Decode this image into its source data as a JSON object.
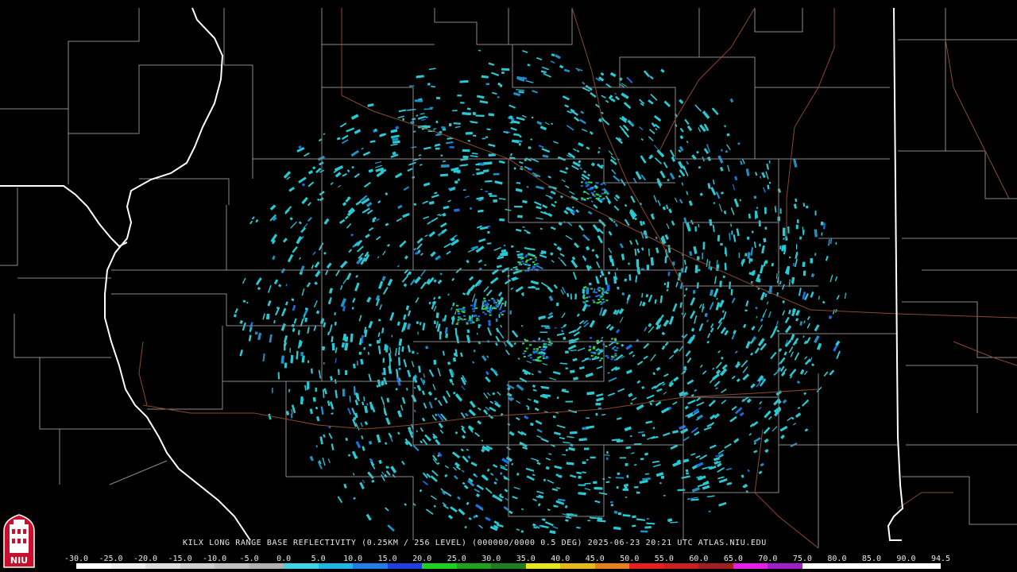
{
  "product": {
    "caption": "KILX LONG RANGE BASE REFLECTIVITY (0.25KM / 256 LEVEL) (000000/0000 0.5 DEG) 2025-06-23 20:21 UTC  ATLAS.NIU.EDU"
  },
  "logo": {
    "text": "NIU",
    "color": "#c8102e"
  },
  "colors": {
    "background": "#000000",
    "county_border": "#8a8a8a",
    "state_border": "#ffffff",
    "road": "#8b4a2b",
    "echo_main": "#29c9d4",
    "echo_weak": "#1e90c8",
    "echo_mid": "#1a6fe0",
    "echo_green": "#33d94a"
  },
  "color_scale": {
    "labels": [
      "-30.0",
      "-25.0",
      "-20.0",
      "-15.0",
      "-10.0",
      "-5.0",
      "0.0",
      "5.0",
      "10.0",
      "15.0",
      "20.0",
      "25.0",
      "30.0",
      "35.0",
      "40.0",
      "45.0",
      "50.0",
      "55.0",
      "60.0",
      "65.0",
      "70.0",
      "75.0",
      "80.0",
      "85.0",
      "90.0",
      "94.5"
    ],
    "colors": [
      "#ffffff",
      "#f0f0f0",
      "#e0e0e0",
      "#d0d0d0",
      "#c0c0c0",
      "#b0b0b0",
      "#3fd3e3",
      "#1fb6e6",
      "#1f7fe6",
      "#1f3fe0",
      "#1fd11f",
      "#1fa11f",
      "#1f7f1f",
      "#e6e61f",
      "#e6b81f",
      "#e6801f",
      "#e61f1f",
      "#c81f1f",
      "#a01f1f",
      "#e61fe6",
      "#a01fc8",
      "#ffffff",
      "#ffffff",
      "#ffffff",
      "#ffffff"
    ]
  }
}
